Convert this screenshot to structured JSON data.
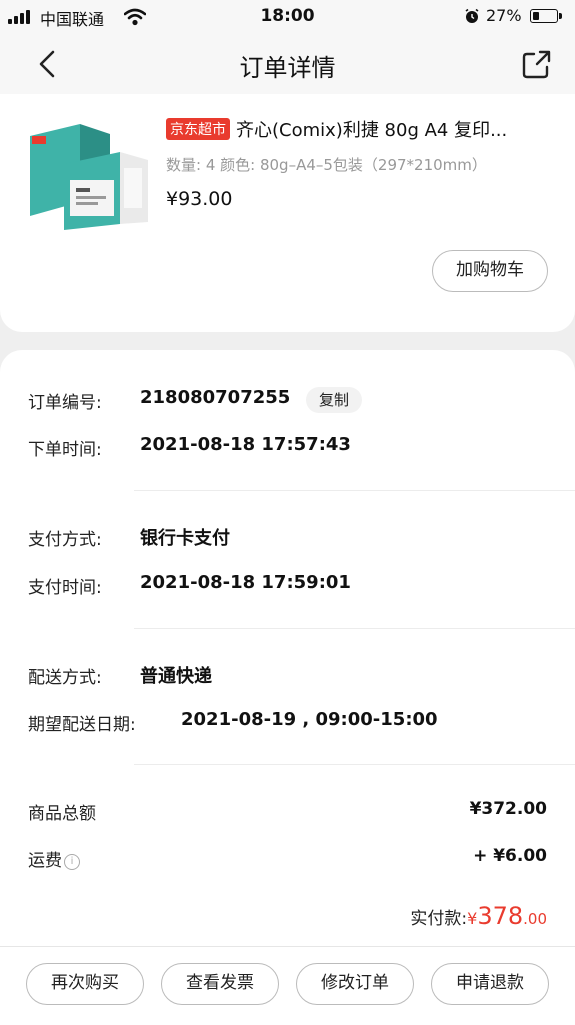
{
  "status_bar": {
    "carrier": "中国联通",
    "time": "18:00",
    "battery": "27%",
    "battery_level": 0.27
  },
  "header": {
    "title": "订单详情"
  },
  "product": {
    "tag": "京东超市",
    "name": "齐心(Comix)利捷 80g A4 复印...",
    "spec": "数量: 4  颜色: 80g–A4–5包装（297*210mm）",
    "price": "¥93.00",
    "add_to_cart": "加购物车"
  },
  "order": {
    "number_label": "订单编号:",
    "number": "218080707255",
    "copy": "复制",
    "time_label": "下单时间:",
    "time": "2021-08-18 17:57:43"
  },
  "payment": {
    "method_label": "支付方式:",
    "method": "银行卡支付",
    "time_label": "支付时间:",
    "time": "2021-08-18 17:59:01"
  },
  "delivery": {
    "method_label": "配送方式:",
    "method": "普通快递",
    "date_label": "期望配送日期:",
    "date": "2021-08-19 , 09:00-15:00"
  },
  "summary": {
    "goods_label": "商品总额",
    "goods_value": "¥372.00",
    "shipping_label": "运费",
    "info_icon_text": "i",
    "shipping_value": "+ ¥6.00",
    "paid_label": "实付款:",
    "paid_symbol": "¥",
    "paid_integer": "378",
    "paid_decimal": ".00"
  },
  "actions": [
    {
      "label": "再次购买"
    },
    {
      "label": "查看发票"
    },
    {
      "label": "修改订单"
    },
    {
      "label": "申请退款"
    }
  ],
  "colors": {
    "accent": "#e93b2e",
    "page_bg": "#efefef",
    "card_bg": "#ffffff",
    "product_box": "#3fb3a8"
  }
}
